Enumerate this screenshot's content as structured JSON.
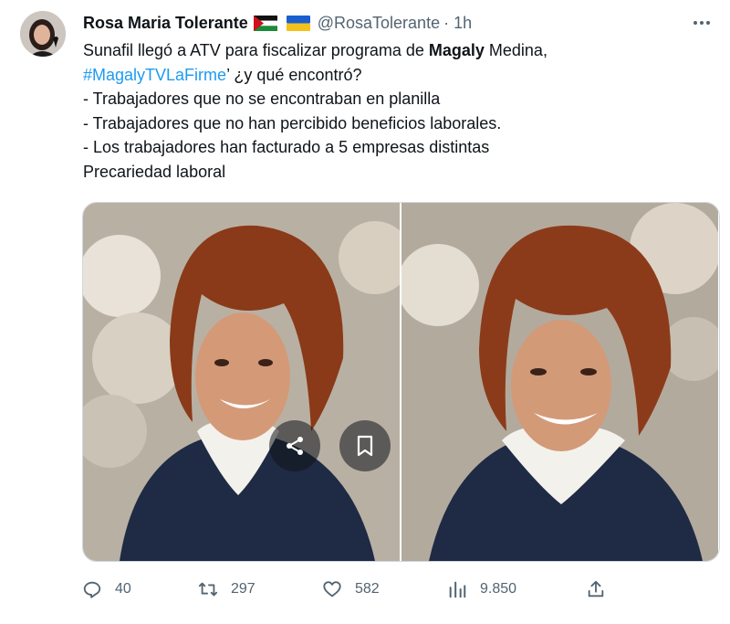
{
  "tweet": {
    "author_name": "Rosa Maria Tolerante",
    "handle": "@RosaTolerante",
    "time": "· 1h",
    "text_line1_pre": "Sunafil llegó a ATV para fiscalizar programa de ",
    "text_line1_bold": "Magaly",
    "text_line1_post": " Medina,",
    "hashtag": "#MagalyTVLaFirme",
    "text_line2_post": "’ ¿y qué encontró?",
    "bullets": [
      "- Trabajadores que no se encontraban en planilla",
      "- Trabajadores que no han percibido beneficios laborales.",
      "- Los trabajadores han facturado a 5 empresas distintas",
      "Precariedad laboral"
    ]
  },
  "actions": {
    "replies": "40",
    "retweets": "297",
    "likes": "582",
    "views": "9.850"
  },
  "icons": [
    "more-icon",
    "share-icon",
    "bookmark-icon",
    "reply-icon",
    "retweet-icon",
    "like-icon",
    "views-icon",
    "share-upload-icon"
  ],
  "colors": {
    "link": "#1d9bf0",
    "secondary": "#536471",
    "primary_text": "#0f1419"
  }
}
